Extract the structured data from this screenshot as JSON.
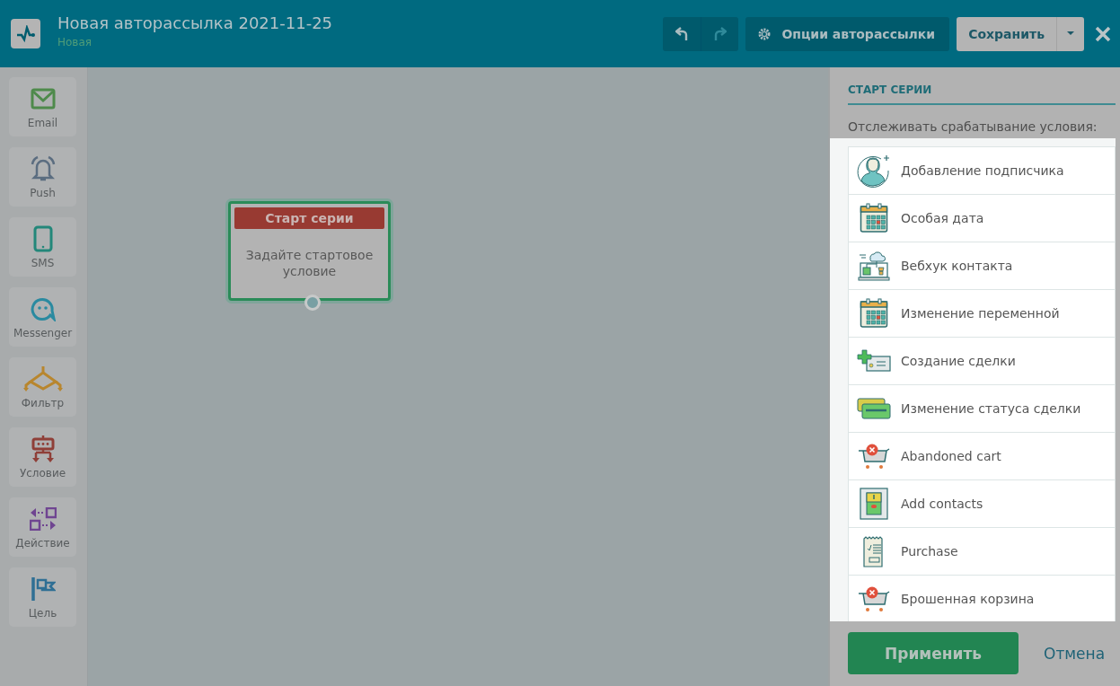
{
  "header": {
    "title": "Новая авторассылка 2021-11-25",
    "status": "Новая",
    "undo": {
      "disabled": false
    },
    "redo": {
      "disabled": true
    },
    "options_button": "Опции авторассылки",
    "save_button": "Сохранить"
  },
  "palette": [
    {
      "kind": "email",
      "label": "Email"
    },
    {
      "kind": "push",
      "label": "Push"
    },
    {
      "kind": "sms",
      "label": "SMS"
    },
    {
      "kind": "messenger",
      "label": "Messenger"
    },
    {
      "kind": "filter",
      "label": "Фильтр"
    },
    {
      "kind": "condition",
      "label": "Условие"
    },
    {
      "kind": "action",
      "label": "Действие"
    },
    {
      "kind": "goal",
      "label": "Цель"
    }
  ],
  "node": {
    "title": "Старт серии",
    "text": "Задайте стартовое условие"
  },
  "panel": {
    "heading": "СТАРТ СЕРИИ",
    "label": "Отслеживать срабатывание условия:",
    "triggers": [
      {
        "kind": "subscriber",
        "label": "Добавление подписчика"
      },
      {
        "kind": "calendar",
        "label": "Особая дата"
      },
      {
        "kind": "webhook",
        "label": "Вебхук контакта"
      },
      {
        "kind": "calendar",
        "label": "Изменение переменной"
      },
      {
        "kind": "deal-create",
        "label": "Создание сделки"
      },
      {
        "kind": "deal-status",
        "label": "Изменение статуса сделки"
      },
      {
        "kind": "cart",
        "label": "Abandoned cart"
      },
      {
        "kind": "contacts",
        "label": "Add contacts"
      },
      {
        "kind": "receipt",
        "label": "Purchase"
      },
      {
        "kind": "cart",
        "label": "Брошенная корзина"
      }
    ],
    "apply_button": "Применить",
    "cancel_link": "Отмена"
  }
}
